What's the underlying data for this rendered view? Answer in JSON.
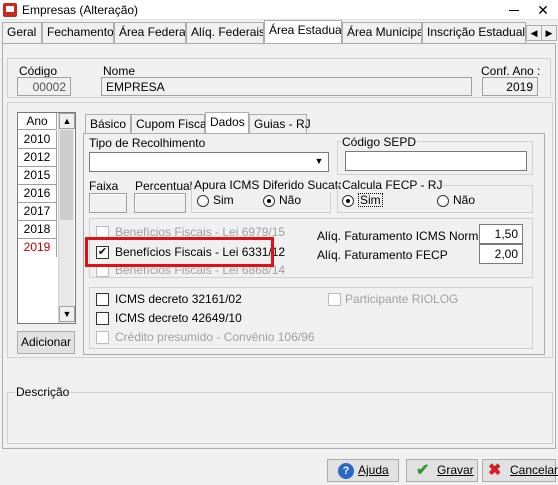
{
  "window": {
    "title": "Empresas (Alteração)",
    "close_glyph": "✕"
  },
  "tabs": [
    "Geral",
    "Fechamento",
    "Área Federal",
    "Alíq. Federais",
    "Área Estadual",
    "Área Municipal",
    "Inscrição Estadual S"
  ],
  "tab_arrows": [
    "◀",
    "▶"
  ],
  "header": {
    "codigo_label": "Código",
    "codigo_value": "00002",
    "nome_label": "Nome",
    "nome_value": "EMPRESA",
    "conf_ano_label": "Conf. Ano :",
    "conf_ano_value": "2019"
  },
  "ano_list": {
    "header": "Ano",
    "years": [
      "2010",
      "2012",
      "2015",
      "2016",
      "2017",
      "2018",
      "2019"
    ],
    "selected": "2019",
    "add_button": "Adicionar",
    "scroll_up": "▲",
    "scroll_down": "▼"
  },
  "inner_tabs": [
    "Básico",
    "Cupom Fiscal",
    "Dados",
    "Guias - RJ"
  ],
  "dados": {
    "tipo_recolhimento_label": "Tipo de Recolhimento",
    "tipo_recolhimento_value": "",
    "combo_arrow": "▼",
    "codigo_sepd_label": "Código SEPD",
    "codigo_sepd_value": "",
    "faixa_label": "Faixa",
    "percentual_label": "Percentual",
    "apura_label": "Apura ICMS Diferido Sucata",
    "apura_sim": "Sim",
    "apura_nao": "Não",
    "apura_selected": "Não",
    "fecp_label": "Calcula FECP - RJ",
    "fecp_sim": "Sim",
    "fecp_nao": "Não",
    "fecp_selected": "Sim"
  },
  "beneficios": {
    "lei6979": "Benefícios Fiscais - Lei 6979/15",
    "lei6331": "Benefícios Fiscais - Lei 6331/12",
    "lei6868": "Benefícios Fiscais - Lei 6868/14",
    "lei6331_checked": true,
    "check_glyph": "✔",
    "aliq_icms_label": "Alíq. Faturamento ICMS Normal",
    "aliq_icms_value": "1,50",
    "aliq_fecp_label": "Alíq. Faturamento FECP",
    "aliq_fecp_value": "2,00"
  },
  "decretos": {
    "icms_32161": "ICMS decreto 32161/02",
    "icms_42649": "ICMS decreto 42649/10",
    "credito_presumido": "Crédito presumido - Convênio 106/96",
    "participante_riolog": "Participante RIOLOG"
  },
  "descricao_label": "Descrição",
  "footer": {
    "ajuda": "Ajuda",
    "gravar": "Gravar",
    "cancelar": "Cancelar"
  },
  "colors": {
    "red_highlight": "#e0101a",
    "selected_year": "#c00000"
  }
}
